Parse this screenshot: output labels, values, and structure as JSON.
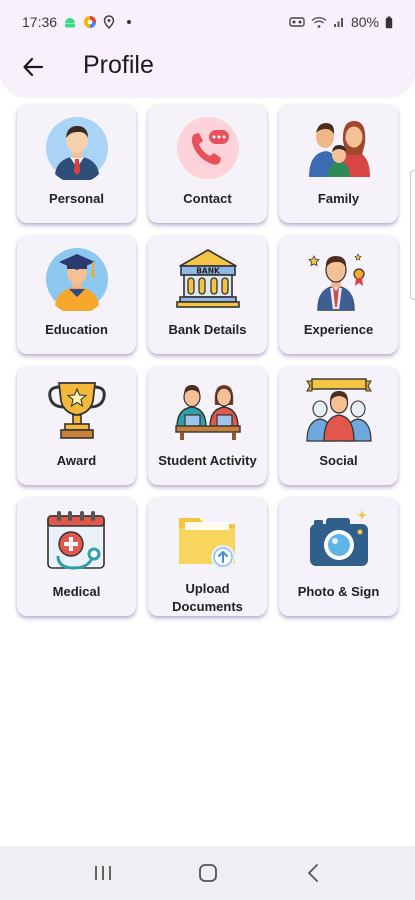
{
  "status_bar": {
    "time": "17:36",
    "battery": "80%"
  },
  "header": {
    "title": "Profile",
    "back_icon": "arrow-left-icon"
  },
  "tiles": [
    {
      "label": "Personal",
      "icon": "person-avatar-icon"
    },
    {
      "label": "Contact",
      "icon": "phone-chat-icon"
    },
    {
      "label": "Family",
      "icon": "family-icon"
    },
    {
      "label": "Education",
      "icon": "graduate-icon"
    },
    {
      "label": "Bank Details",
      "icon": "bank-icon"
    },
    {
      "label": "Experience",
      "icon": "employee-award-icon"
    },
    {
      "label": "Award",
      "icon": "trophy-icon"
    },
    {
      "label": "Student Activity",
      "icon": "students-desk-icon"
    },
    {
      "label": "Social",
      "icon": "group-banner-icon"
    },
    {
      "label": "Medical",
      "icon": "medical-calendar-icon"
    },
    {
      "label": "Upload Documents",
      "icon": "folder-upload-icon"
    },
    {
      "label": "Photo & Sign",
      "icon": "camera-icon"
    }
  ],
  "nav_bar": {
    "recent_icon": "recent-apps-icon",
    "home_icon": "home-icon",
    "back_icon": "back-icon"
  },
  "colors": {
    "header_bg": "#f8f0fa",
    "tile_bg": "#f5f2f9",
    "nav_bg": "#f0edf3"
  }
}
